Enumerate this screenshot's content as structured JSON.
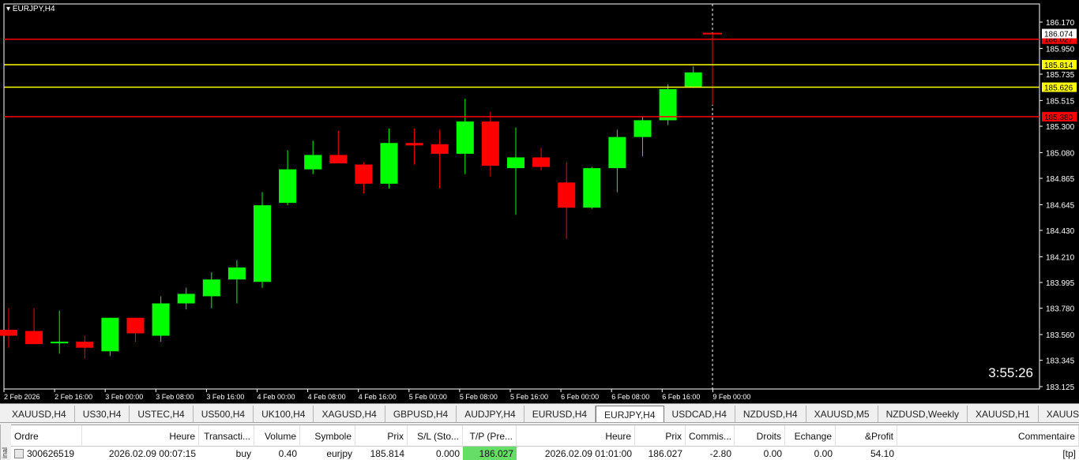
{
  "chart": {
    "symbol_title": "EURJPY,H4",
    "timer": "3:55:26",
    "colors": {
      "bull": "#00ff00",
      "bear": "#ff0000",
      "wick_bull": "#00ff00",
      "wick_bear": "#ff0000",
      "axis_text": "#ffffff",
      "background": "#000000"
    },
    "price_axis_labels": [
      "186.170",
      "185.950",
      "185.735",
      "185.515",
      "185.300",
      "185.080",
      "184.865",
      "184.645",
      "184.430",
      "184.210",
      "183.995",
      "183.780",
      "183.560",
      "183.345",
      "183.125"
    ],
    "time_axis_labels": [
      "2 Feb 2026",
      "2 Feb 16:00",
      "3 Feb 00:00",
      "3 Feb 08:00",
      "3 Feb 16:00",
      "4 Feb 00:00",
      "4 Feb 08:00",
      "4 Feb 16:00",
      "5 Feb 00:00",
      "5 Feb 08:00",
      "5 Feb 16:00",
      "6 Feb 00:00",
      "6 Feb 08:00",
      "6 Feb 16:00",
      "9 Feb 00:00"
    ],
    "hlines": [
      {
        "price": 186.027,
        "label": "186.027",
        "color": "#ff0000"
      },
      {
        "price": 185.814,
        "label": "185.814",
        "color": "#ffff00"
      },
      {
        "price": 185.626,
        "label": "185.626",
        "color": "#ffff00"
      },
      {
        "price": 185.38,
        "label": "185.380",
        "color": "#ff0000"
      }
    ],
    "current_price_label": "186.074",
    "candles": [
      {
        "o": 183.6,
        "h": 183.78,
        "l": 183.45,
        "c": 183.55
      },
      {
        "o": 183.59,
        "h": 183.78,
        "l": 183.49,
        "c": 183.48
      },
      {
        "o": 183.5,
        "h": 183.76,
        "l": 183.4,
        "c": 183.5
      },
      {
        "o": 183.5,
        "h": 183.55,
        "l": 183.36,
        "c": 183.45
      },
      {
        "o": 183.42,
        "h": 183.7,
        "l": 183.38,
        "c": 183.7
      },
      {
        "o": 183.7,
        "h": 183.7,
        "l": 183.5,
        "c": 183.57
      },
      {
        "o": 183.55,
        "h": 183.88,
        "l": 183.5,
        "c": 183.82
      },
      {
        "o": 183.82,
        "h": 183.95,
        "l": 183.77,
        "c": 183.9
      },
      {
        "o": 183.88,
        "h": 184.08,
        "l": 183.78,
        "c": 184.02
      },
      {
        "o": 184.02,
        "h": 184.18,
        "l": 183.82,
        "c": 184.12
      },
      {
        "o": 184.0,
        "h": 184.75,
        "l": 183.95,
        "c": 184.64
      },
      {
        "o": 184.66,
        "h": 185.1,
        "l": 184.64,
        "c": 184.94
      },
      {
        "o": 184.94,
        "h": 185.18,
        "l": 184.9,
        "c": 185.06
      },
      {
        "o": 185.06,
        "h": 185.26,
        "l": 185.0,
        "c": 184.99
      },
      {
        "o": 184.98,
        "h": 185.0,
        "l": 184.74,
        "c": 184.82
      },
      {
        "o": 184.82,
        "h": 185.28,
        "l": 184.78,
        "c": 185.16
      },
      {
        "o": 185.16,
        "h": 185.28,
        "l": 184.98,
        "c": 185.14
      },
      {
        "o": 185.15,
        "h": 185.27,
        "l": 184.78,
        "c": 185.07
      },
      {
        "o": 185.07,
        "h": 185.53,
        "l": 184.9,
        "c": 185.34
      },
      {
        "o": 185.34,
        "h": 185.42,
        "l": 184.88,
        "c": 184.97
      },
      {
        "o": 184.95,
        "h": 185.29,
        "l": 184.56,
        "c": 185.04
      },
      {
        "o": 185.04,
        "h": 185.12,
        "l": 184.93,
        "c": 184.96
      },
      {
        "o": 184.83,
        "h": 185.0,
        "l": 184.36,
        "c": 184.62
      },
      {
        "o": 184.62,
        "h": 184.96,
        "l": 184.61,
        "c": 184.95
      },
      {
        "o": 184.95,
        "h": 185.27,
        "l": 184.75,
        "c": 185.21
      },
      {
        "o": 185.21,
        "h": 185.38,
        "l": 185.05,
        "c": 185.35
      },
      {
        "o": 185.35,
        "h": 185.65,
        "l": 185.31,
        "c": 185.61
      },
      {
        "o": 185.63,
        "h": 185.8,
        "l": 185.62,
        "c": 185.75
      }
    ]
  },
  "tabs": [
    {
      "label": "XAUUSD,H4",
      "active": false
    },
    {
      "label": "US30,H4",
      "active": false
    },
    {
      "label": "USTEC,H4",
      "active": false
    },
    {
      "label": "US500,H4",
      "active": false
    },
    {
      "label": "UK100,H4",
      "active": false
    },
    {
      "label": "XAGUSD,H4",
      "active": false
    },
    {
      "label": "GBPUSD,H4",
      "active": false
    },
    {
      "label": "AUDJPY,H4",
      "active": false
    },
    {
      "label": "EURUSD,H4",
      "active": false
    },
    {
      "label": "EURJPY,H4",
      "active": true
    },
    {
      "label": "USDCAD,H4",
      "active": false
    },
    {
      "label": "NZDUSD,H4",
      "active": false
    },
    {
      "label": "XAUUSD,M5",
      "active": false
    },
    {
      "label": "NZDUSD,Weekly",
      "active": false
    },
    {
      "label": "XAUUSD,H1",
      "active": false
    },
    {
      "label": "XAUUSD,Weekly",
      "active": false
    }
  ],
  "terminal": {
    "side_label": "inal",
    "headers": [
      "Ordre",
      "Heure",
      "Transacti...",
      "Volume",
      "Symbole",
      "Prix",
      "S/L (Sto...",
      "T/P (Pre...",
      "Heure",
      "Prix",
      "Commis...",
      "Droits",
      "Echange",
      "&Profit",
      "Commentaire"
    ],
    "row": [
      "300626519",
      "2026.02.09 00:07:15",
      "buy",
      "0.40",
      "eurjpy",
      "185.814",
      "0.000",
      "186.027",
      "2026.02.09 01:01:00",
      "186.027",
      "-2.80",
      "0.00",
      "0.00",
      "54.10",
      "[tp]"
    ],
    "tp_highlight": "#66dd66"
  }
}
